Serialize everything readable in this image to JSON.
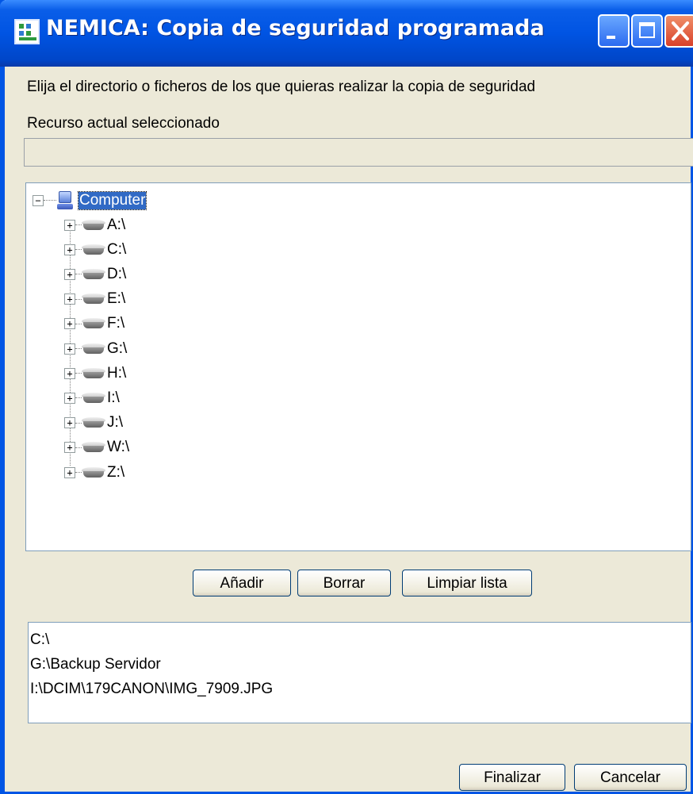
{
  "window": {
    "title": "NEMICA: Copia de seguridad programada",
    "accent": "#0055e5"
  },
  "main": {
    "instruction": "Elija el directorio o ficheros de los que quieras realizar la copia de seguridad",
    "resource_label": "Recurso actual seleccionado",
    "resource_value": ""
  },
  "tree": {
    "root": {
      "label": "Computer",
      "icon": "computer-icon",
      "expanded": true,
      "selected": true
    },
    "drives": [
      {
        "label": "A:\\",
        "icon": "drive-icon"
      },
      {
        "label": "C:\\",
        "icon": "drive-icon"
      },
      {
        "label": "D:\\",
        "icon": "drive-icon"
      },
      {
        "label": "E:\\",
        "icon": "drive-icon"
      },
      {
        "label": "F:\\",
        "icon": "drive-icon"
      },
      {
        "label": "G:\\",
        "icon": "drive-icon"
      },
      {
        "label": "H:\\",
        "icon": "drive-icon"
      },
      {
        "label": "I:\\",
        "icon": "drive-icon"
      },
      {
        "label": "J:\\",
        "icon": "drive-icon"
      },
      {
        "label": "W:\\",
        "icon": "drive-icon"
      },
      {
        "label": "Z:\\",
        "icon": "drive-icon"
      }
    ]
  },
  "actions": {
    "add": "Añadir",
    "delete": "Borrar",
    "clear": "Limpiar lista"
  },
  "selected_list": [
    "C:\\",
    "G:\\Backup Servidor",
    "I:\\DCIM\\179CANON\\IMG_7909.JPG"
  ],
  "footer": {
    "finish": "Finalizar",
    "cancel": "Cancelar"
  }
}
